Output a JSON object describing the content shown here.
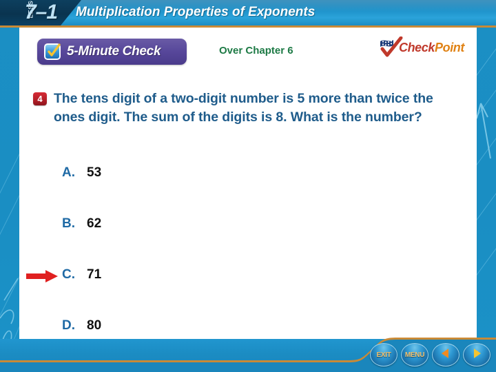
{
  "banner": {
    "lesson_word": "LESSON",
    "lesson_number": "7–1",
    "title": "Multiplication Properties of Exponents"
  },
  "check_bar": {
    "check_label": "5-Minute Check",
    "check_icon": "checkbox-check-icon",
    "over_label": "Over Chapter 6"
  },
  "logo": {
    "mark_icon": "checkpoint-flag-check-icon",
    "word_check": "Check",
    "word_point": "Point"
  },
  "question": {
    "number": "4",
    "text": "The tens digit of a two-digit number is 5 more than twice the ones digit. The sum of the digits is 8. What is the number?"
  },
  "choices": [
    {
      "letter": "A.",
      "value": "53",
      "marked": false
    },
    {
      "letter": "B.",
      "value": "62",
      "marked": false
    },
    {
      "letter": "C.",
      "value": "71",
      "marked": true
    },
    {
      "letter": "D.",
      "value": "80",
      "marked": false
    }
  ],
  "nav": {
    "exit_label": "EXIT",
    "menu_label": "MENU",
    "back_icon": "triangle-left-icon",
    "forward_icon": "triangle-right-icon"
  },
  "colors": {
    "banner_blue": "#1e93cb",
    "strip_blue": "#1b8fc4",
    "gold": "#c98a36",
    "purple_pill": "#57479a",
    "question_blue": "#1f5c8b",
    "green": "#1d7a45",
    "red_badge": "#b21f28",
    "arrow_red": "#e02020",
    "logo_check": "#c0392b",
    "logo_point": "#e08214"
  }
}
